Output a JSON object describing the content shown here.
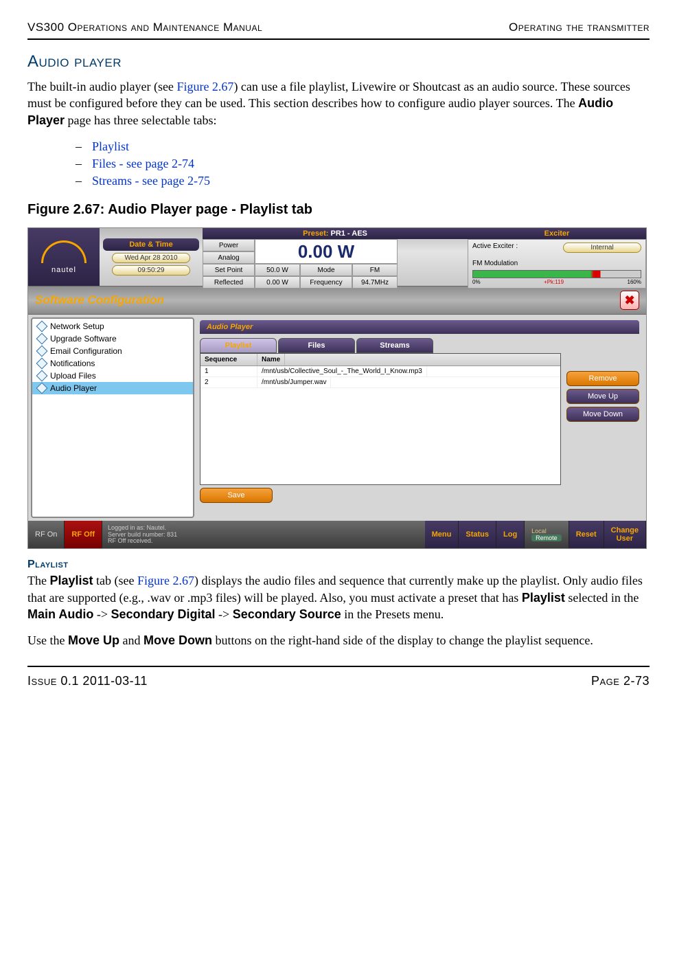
{
  "header": {
    "left": "VS300 Operations and Maintenance Manual",
    "right": "Operating the transmitter"
  },
  "section": {
    "title": "Audio player"
  },
  "para1": {
    "pre": "The built-in audio player (see ",
    "figref": "Figure 2.67",
    "mid": ") can use a file playlist, Livewire or Shoutcast as an audio source. These sources must be configured before they can be used. This section describes how to configure audio player sources. The ",
    "bold": "Audio Player",
    "post": " page has three selectable tabs:"
  },
  "list": {
    "a": "Playlist",
    "b": "Files - see page 2-74",
    "c": "Streams - see page 2-75"
  },
  "figcap": "Figure 2.67: Audio Player page - Playlist tab",
  "shot": {
    "logo": "nautel",
    "dt_head": "Date & Time",
    "date": "Wed Apr 28 2010",
    "time": "09:50:29",
    "preset_label": "Preset:",
    "preset_value": " PR1 - AES",
    "grid": {
      "power": "Power",
      "analog": "Analog",
      "bigpower": "0.00 W",
      "setpoint": "Set Point",
      "setpoint_v": "50.0 W",
      "mode": "Mode",
      "mode_v": "FM",
      "reflected": "Reflected",
      "reflected_v": "0.00 W",
      "freq": "Frequency",
      "freq_v": "94.7MHz"
    },
    "exciter": {
      "head": "Exciter",
      "active": "Active Exciter :",
      "internal": "Internal",
      "fm_mod": "FM Modulation",
      "zero": "0%",
      "pk": "+Pk:119",
      "max": "160%"
    },
    "banner": "Software Configuration",
    "nav": [
      "Network Setup",
      "Upgrade Software",
      "Email Configuration",
      "Notifications",
      "Upload Files",
      "Audio Player"
    ],
    "ap_title": "Audio Player",
    "tabs": {
      "pl": "Playlist",
      "fi": "Files",
      "st": "Streams"
    },
    "th_seq": "Sequence",
    "th_name": "Name",
    "rows": [
      {
        "seq": "1",
        "name": "/mnt/usb/Collective_Soul_-_The_World_I_Know.mp3"
      },
      {
        "seq": "2",
        "name": "/mnt/usb/Jumper.wav"
      }
    ],
    "btn_remove": "Remove",
    "btn_up": "Move Up",
    "btn_down": "Move Down",
    "btn_save": "Save",
    "bb": {
      "rfon": "RF On",
      "rfoff": "RF Off",
      "info1": "Logged in as:    Nautel.",
      "info2": "Server build number: 831",
      "info3": "RF Off received.",
      "menu": "Menu",
      "status": "Status",
      "log": "Log",
      "local": "Local",
      "remote": "Remote",
      "reset": "Reset",
      "change": "Change\nUser"
    }
  },
  "sub": {
    "title": "Playlist"
  },
  "para2": {
    "pre": "The ",
    "b1": "Playlist",
    "mid1": " tab (see ",
    "figref": "Figure 2.67",
    "mid2": ") displays the audio files and sequence that currently make up the playlist. Only audio files that are supported (e.g., .wav or .mp3 files) will be played. Also, you must activate a preset that has ",
    "b2": "Playlist",
    "mid3": " selected in the ",
    "b3": "Main Audio",
    "arr1": " -> ",
    "b4": "Secondary Digital",
    "arr2": " -> ",
    "b5": "Secondary Source",
    "post": " in the Presets menu."
  },
  "para3": {
    "pre": "Use the ",
    "b1": "Move Up",
    "mid": " and ",
    "b2": "Move Down",
    "post": " buttons on the right-hand side of the display to change the playlist sequence."
  },
  "footer": {
    "left": "Issue 0.1  2011-03-11",
    "right": "Page 2-73"
  }
}
